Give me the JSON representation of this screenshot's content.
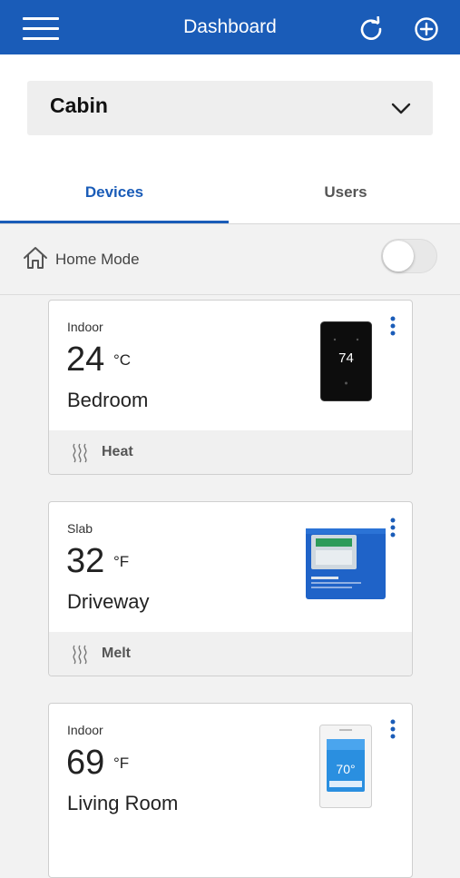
{
  "header": {
    "title": "Dashboard",
    "menu_icon": "hamburger-menu-icon",
    "refresh_icon": "refresh-icon",
    "add_icon": "add-circle-icon",
    "color": "#1a5cb8"
  },
  "location_select": {
    "value": "Cabin",
    "icon": "chevron-down-icon"
  },
  "tabs": [
    {
      "label": "Devices",
      "active": true
    },
    {
      "label": "Users",
      "active": false
    }
  ],
  "home_mode": {
    "label": "Home Mode",
    "icon": "home-icon",
    "enabled": false
  },
  "devices": [
    {
      "type": "Indoor",
      "temperature": "24",
      "unit": "°C",
      "name": "Bedroom",
      "mode": "Heat",
      "display": "74",
      "menu_icon": "more-vertical-icon",
      "mode_icon": "heat-waves-icon"
    },
    {
      "type": "Slab",
      "temperature": "32",
      "unit": "°F",
      "name": "Driveway",
      "mode": "Melt",
      "menu_icon": "more-vertical-icon",
      "mode_icon": "heat-waves-icon"
    },
    {
      "type": "Indoor",
      "temperature": "69",
      "unit": "°F",
      "name": "Living Room",
      "display": "70°",
      "menu_icon": "more-vertical-icon"
    }
  ]
}
